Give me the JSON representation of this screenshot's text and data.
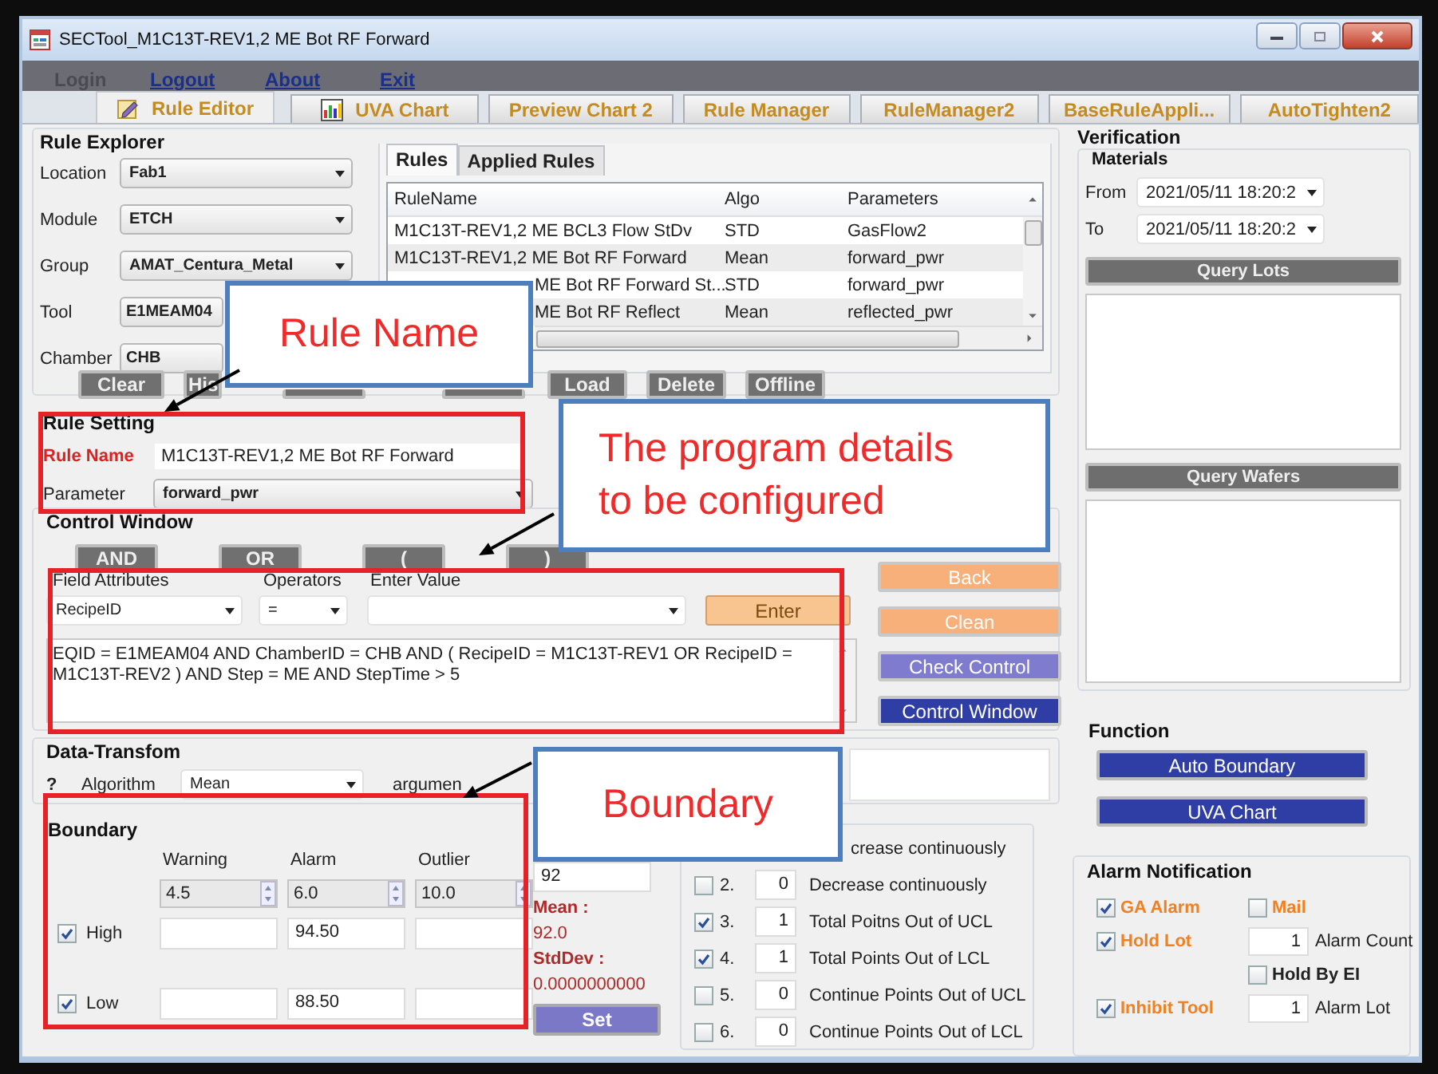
{
  "window": {
    "title": "SECTool_M1C13T-REV1,2 ME Bot RF Forward"
  },
  "menu": [
    {
      "label": "Login",
      "disabled": true
    },
    {
      "label": "Logout",
      "disabled": false
    },
    {
      "label": "About",
      "disabled": false
    },
    {
      "label": "Exit",
      "disabled": false
    }
  ],
  "tabs": [
    {
      "label": "Rule Editor",
      "selected": true,
      "kind": "editor"
    },
    {
      "label": "UVA Chart",
      "selected": false,
      "kind": "chart"
    },
    {
      "label": "Preview Chart 2",
      "selected": false,
      "kind": "text"
    },
    {
      "label": "Rule Manager",
      "selected": false,
      "kind": "text"
    },
    {
      "label": "RuleManager2",
      "selected": false,
      "kind": "text"
    },
    {
      "label": "BaseRuleAppli...",
      "selected": false,
      "kind": "text"
    },
    {
      "label": "AutoTighten2",
      "selected": false,
      "kind": "text"
    }
  ],
  "rule_explorer": {
    "title": "Rule Explorer",
    "filters": [
      {
        "label": "Location",
        "value": "Fab1"
      },
      {
        "label": "Module",
        "value": "ETCH"
      },
      {
        "label": "Group",
        "value": "AMAT_Centura_Metal"
      },
      {
        "label": "Tool",
        "value": "E1MEAM04"
      },
      {
        "label": "Chamber",
        "value": "CHB"
      }
    ],
    "list_tabs": [
      {
        "label": "Rules",
        "selected": true
      },
      {
        "label": "Applied Rules",
        "selected": false
      }
    ],
    "table": {
      "columns": [
        "RuleName",
        "Algo",
        "Parameters"
      ],
      "rows": [
        {
          "cells": [
            "M1C13T-REV1,2 ME BCL3 Flow StDv",
            "STD",
            "GasFlow2"
          ],
          "kind": "full"
        },
        {
          "cells": [
            "M1C13T-REV1,2 ME Bot RF Forward",
            "Mean",
            "forward_pwr"
          ],
          "kind": "full"
        },
        {
          "cells": [
            "ME Bot RF Forward St...",
            "STD",
            "forward_pwr"
          ],
          "kind": "covered"
        },
        {
          "cells": [
            "ME Bot RF Reflect",
            "Mean",
            "reflected_pwr"
          ],
          "kind": "covered"
        }
      ]
    },
    "buttons": [
      {
        "label": "Clear",
        "kind": "shown"
      },
      {
        "label": "His",
        "kind": "shown"
      },
      {
        "kind": "covered"
      },
      {
        "kind": "covered"
      },
      {
        "label": "Load",
        "kind": "shown"
      },
      {
        "label": "Delete",
        "kind": "shown"
      },
      {
        "label": "Offline",
        "kind": "shown"
      }
    ]
  },
  "rule_setting": {
    "title": "Rule Setting",
    "rule_name_label": "Rule Name",
    "rule_name": "M1C13T-REV1,2 ME Bot RF Forward",
    "parameter_label": "Parameter",
    "parameter": "forward_pwr"
  },
  "control_window": {
    "title": "Control Window",
    "operators": [
      "AND",
      "OR",
      "(",
      ")"
    ],
    "field_labels": [
      "Field Attributes",
      "Operators",
      "Enter Value"
    ],
    "field_attribute": "RecipeID",
    "operator": "=",
    "enter_button": "Enter",
    "expression": "EQID = E1MEAM04 AND ChamberID = CHB AND ( RecipeID = M1C13T-REV1 OR RecipeID = M1C13T-REV2 ) AND Step = ME AND StepTime > 5",
    "side_buttons": [
      {
        "label": "Back",
        "kind": "warm"
      },
      {
        "label": "Clean",
        "kind": "warm"
      },
      {
        "label": "Check Control",
        "kind": "check"
      },
      {
        "label": "Control Window",
        "kind": "primary"
      }
    ]
  },
  "data_transform": {
    "title": "Data-Transfom",
    "help": "?",
    "algorithm_label": "Algorithm",
    "algorithm": "Mean",
    "argument_label": "argumen"
  },
  "boundary": {
    "title": "Boundary",
    "columns": [
      "Warning",
      "Alarm",
      "Outlier"
    ],
    "spinners": [
      "4.5",
      "6.0",
      "10.0"
    ],
    "rows": [
      {
        "label": "High",
        "checked": true,
        "alarm": "94.50"
      },
      {
        "label": "Low",
        "checked": true,
        "alarm": "88.50"
      }
    ]
  },
  "stats": {
    "target": "92",
    "mean_label": "Mean :",
    "mean": "92.0",
    "stddev_label": "StdDev :",
    "stddev": "0.0000000000",
    "set_button": "Set"
  },
  "check_rules": [
    {
      "description": "crease continuously",
      "kind": "covered"
    },
    {
      "number": "2.",
      "checked": false,
      "count": "0",
      "description": "Decrease continuously",
      "kind": "full"
    },
    {
      "number": "3.",
      "checked": true,
      "count": "1",
      "description": "Total Poitns Out of UCL",
      "kind": "full"
    },
    {
      "number": "4.",
      "checked": true,
      "count": "1",
      "description": "Total Points Out of LCL",
      "kind": "full"
    },
    {
      "number": "5.",
      "checked": false,
      "count": "0",
      "description": "Continue Points Out of UCL",
      "kind": "full"
    },
    {
      "number": "6.",
      "checked": false,
      "count": "0",
      "description": "Continue Points Out of LCL",
      "kind": "full"
    }
  ],
  "verification": {
    "title": "Verification",
    "materials_title": "Materials",
    "from_label": "From",
    "from": "2021/05/11 18:20:2",
    "to_label": "To",
    "to": "2021/05/11 18:20:2",
    "query_lots": "Query Lots",
    "query_wafers": "Query Wafers"
  },
  "function": {
    "title": "Function",
    "buttons": [
      "Auto Boundary",
      "UVA Chart"
    ]
  },
  "alarm_notification": {
    "title": "Alarm Notification",
    "options": [
      {
        "label": "GA Alarm",
        "checked": true
      },
      {
        "label": "Mail",
        "checked": false
      },
      {
        "label": "Hold Lot",
        "checked": true
      },
      {
        "label": "Hold By EI",
        "checked": false
      },
      {
        "label": "Inhibit Tool",
        "checked": true
      }
    ],
    "counts": [
      {
        "value": "1",
        "label": "Alarm Count"
      },
      {
        "value": "1",
        "label": "Alarm Lot"
      }
    ]
  },
  "annotations": [
    {
      "text": "Rule Name"
    },
    {
      "text": "The program details to be configured"
    },
    {
      "text": "Boundary"
    }
  ]
}
